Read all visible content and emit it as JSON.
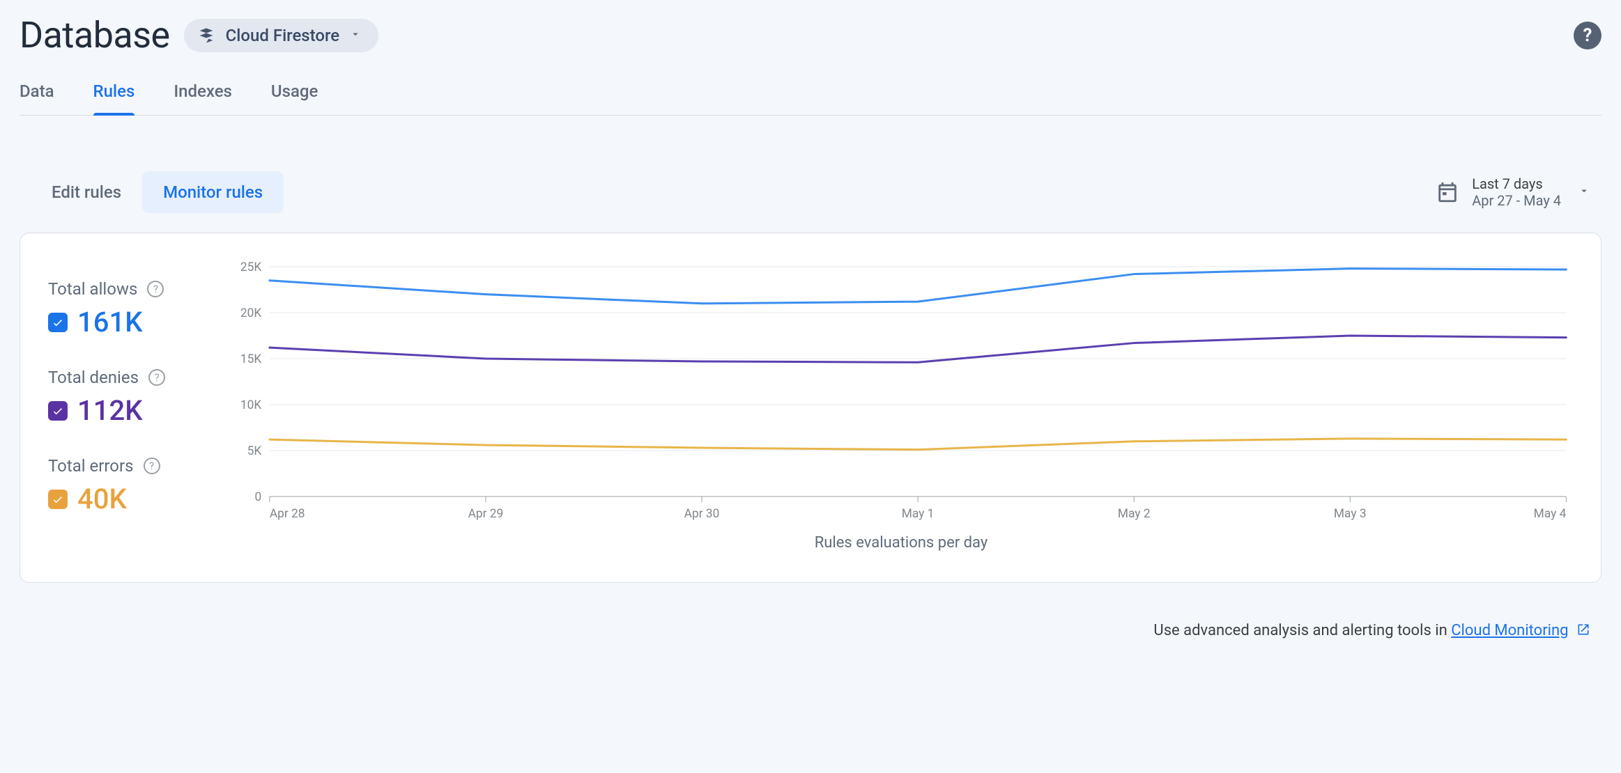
{
  "header": {
    "title": "Database",
    "db_selector": {
      "label": "Cloud Firestore"
    }
  },
  "tabs": [
    {
      "label": "Data",
      "active": false
    },
    {
      "label": "Rules",
      "active": true
    },
    {
      "label": "Indexes",
      "active": false
    },
    {
      "label": "Usage",
      "active": false
    }
  ],
  "subtabs": [
    {
      "label": "Edit rules",
      "active": false
    },
    {
      "label": "Monitor rules",
      "active": true
    }
  ],
  "date_picker": {
    "range_label": "Last 7 days",
    "range_dates": "Apr 27 - May 4"
  },
  "legend": {
    "allows": {
      "title": "Total allows",
      "value": "161K",
      "color": "#1a73e8"
    },
    "denies": {
      "title": "Total denies",
      "value": "112K",
      "color": "#5a32a3"
    },
    "errors": {
      "title": "Total errors",
      "value": "40K",
      "color": "#e8a23d"
    }
  },
  "footer": {
    "prefix": "Use advanced analysis and alerting tools in ",
    "link_label": "Cloud Monitoring"
  },
  "chart_data": {
    "type": "line",
    "title": "",
    "xlabel": "Rules evaluations per day",
    "ylabel": "",
    "ylim": [
      0,
      25000
    ],
    "y_ticks": [
      0,
      5000,
      10000,
      15000,
      20000,
      25000
    ],
    "y_tick_labels": [
      "0",
      "5K",
      "10K",
      "15K",
      "20K",
      "25K"
    ],
    "categories": [
      "Apr 28",
      "Apr 29",
      "Apr 30",
      "May 1",
      "May 2",
      "May 3",
      "May 4"
    ],
    "series": [
      {
        "name": "Total allows",
        "color": "#3b8ef0",
        "values": [
          23500,
          22000,
          21000,
          21200,
          24200,
          24800,
          24700
        ]
      },
      {
        "name": "Total denies",
        "color": "#5c3fb0",
        "values": [
          16200,
          15000,
          14700,
          14600,
          16700,
          17500,
          17300
        ]
      },
      {
        "name": "Total errors",
        "color": "#e8b54a",
        "values": [
          6200,
          5600,
          5300,
          5100,
          6000,
          6300,
          6200
        ]
      }
    ]
  }
}
